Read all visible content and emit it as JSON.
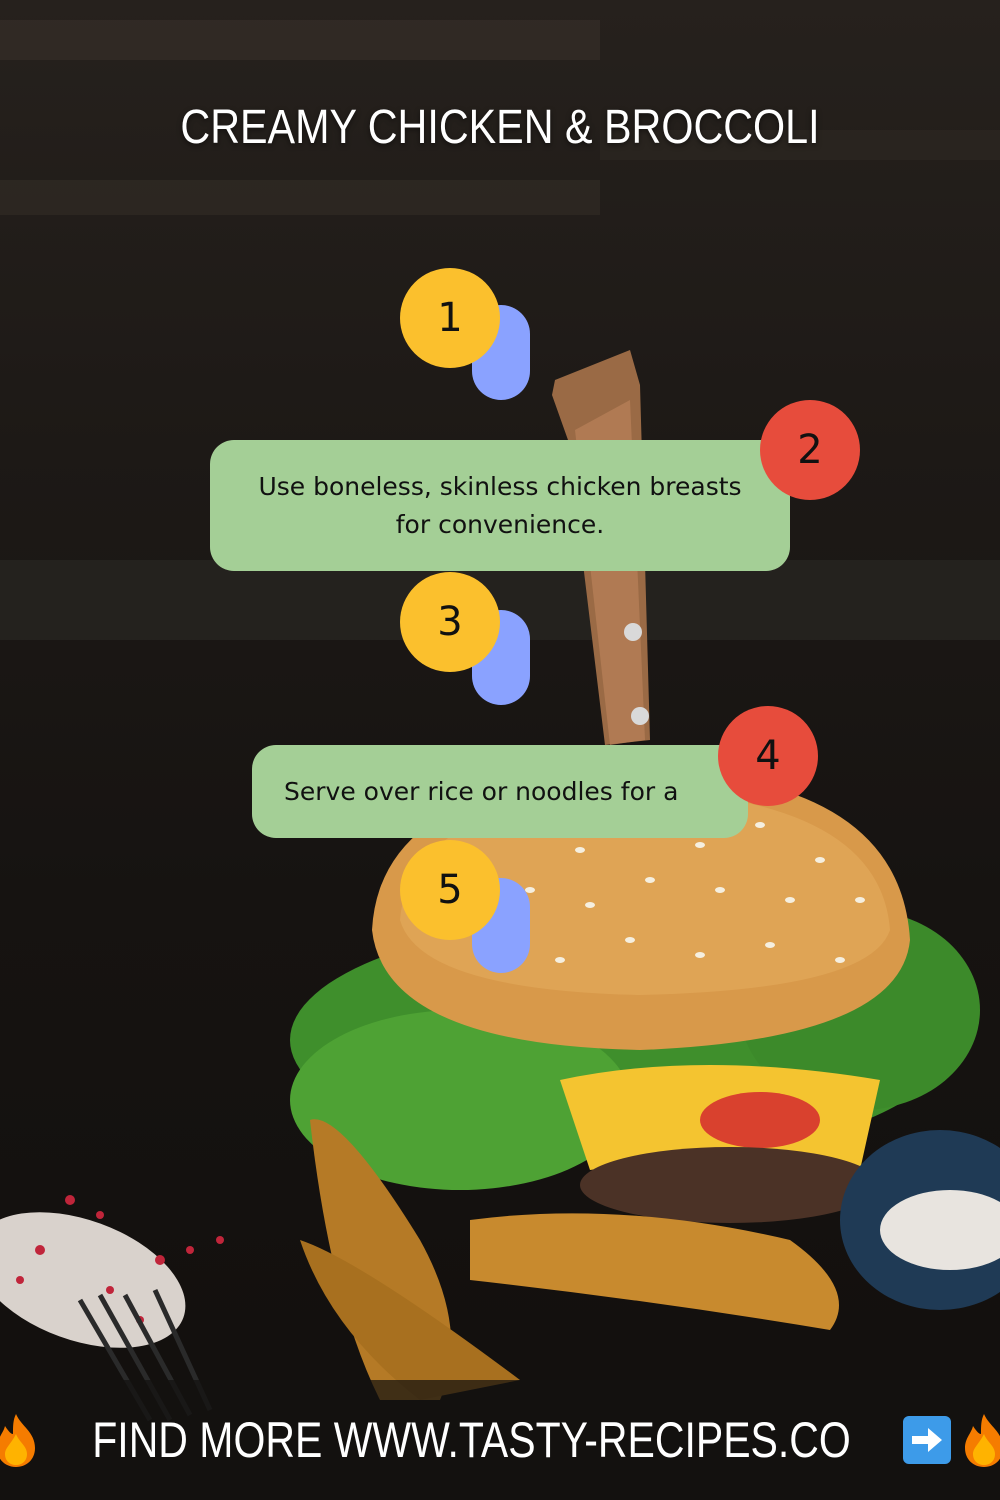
{
  "title": "CREAMY CHICKEN & BROCCOLI",
  "steps": [
    {
      "number": "1"
    },
    {
      "number": "2",
      "text_lines": [
        "Use boneless, skinless chicken breasts",
        "for convenience."
      ]
    },
    {
      "number": "3"
    },
    {
      "number": "4",
      "text_lines": [
        "Serve over rice or noodles for a"
      ]
    },
    {
      "number": "5"
    }
  ],
  "footer": {
    "text": "FIND MORE WWW.TASTY-RECIPES.CO",
    "left_icon": "fire-icon",
    "right_icons": [
      "right-arrow-icon",
      "fire-icon"
    ]
  },
  "colors": {
    "yellow_circle": "#fbc02d",
    "red_circle": "#e74c3c",
    "blue_pill": "#8aa2ff",
    "green_card": "#a4cf96",
    "footer_bar": "#141211"
  }
}
